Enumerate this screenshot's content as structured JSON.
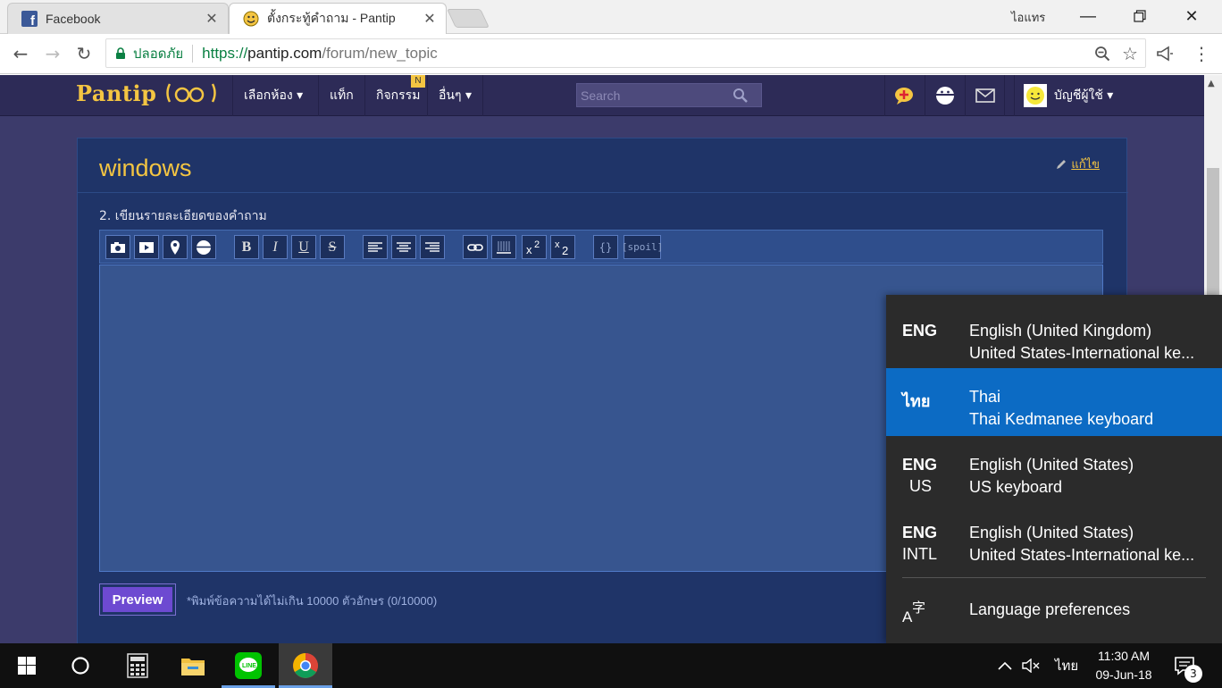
{
  "browser": {
    "tabs": [
      {
        "title": "Facebook",
        "favicon": "facebook-icon",
        "active": false
      },
      {
        "title": "ตั้งกระทู้คำถาม - Pantip",
        "favicon": "pantip-icon",
        "active": true
      }
    ],
    "window_user": "ไอแทร",
    "address": {
      "secure_label": "ปลอดภัย",
      "proto": "https://",
      "host": "pantip.com",
      "path": "/forum/new_topic"
    }
  },
  "pantip": {
    "logo": "Pantip",
    "nav": {
      "rooms": "เลือกห้อง ▾",
      "tags": "แท็ก",
      "activities": "กิจกรรม",
      "activities_badge": "N",
      "more": "อื่นๆ ▾"
    },
    "search_placeholder": "Search",
    "user_label": "บัญชีผู้ใช้ ▾",
    "topic_title": "windows",
    "edit_label": "แก้ไข",
    "step_label": "2. เขียนรายละเอียดของคำถาม",
    "toolbar": {
      "bold": "B",
      "italic": "I",
      "underline": "U",
      "strike": "S",
      "code": "{}",
      "spoil": "[spoil]"
    },
    "preview_label": "Preview",
    "char_hint": "*พิมพ์ข้อความได้ไม่เกิน 10000 ตัวอักษร (0/10000)"
  },
  "language_flyout": {
    "items": [
      {
        "code": "ENG",
        "sub": "",
        "name": "English (United Kingdom)",
        "keyboard": "United States-International ke...",
        "selected": false
      },
      {
        "code": "ไทย",
        "sub": "",
        "name": "Thai",
        "keyboard": "Thai Kedmanee keyboard",
        "selected": true
      },
      {
        "code": "ENG",
        "sub": "US",
        "name": "English (United States)",
        "keyboard": "US keyboard",
        "selected": false
      },
      {
        "code": "ENG",
        "sub": "INTL",
        "name": "English (United States)",
        "keyboard": "United States-International ke...",
        "selected": false
      }
    ],
    "preferences_label": "Language preferences"
  },
  "taskbar": {
    "input_indicator": "ไทย",
    "time": "11:30 AM",
    "date": "09-Jun-18",
    "notification_count": "3"
  },
  "colors": {
    "page_bg": "#3c3b6b",
    "panel_bg": "#1f3468",
    "accent_yellow": "#f4c542",
    "flyout_selected": "#0c6bc4",
    "preview_button": "#6d4ad1"
  }
}
